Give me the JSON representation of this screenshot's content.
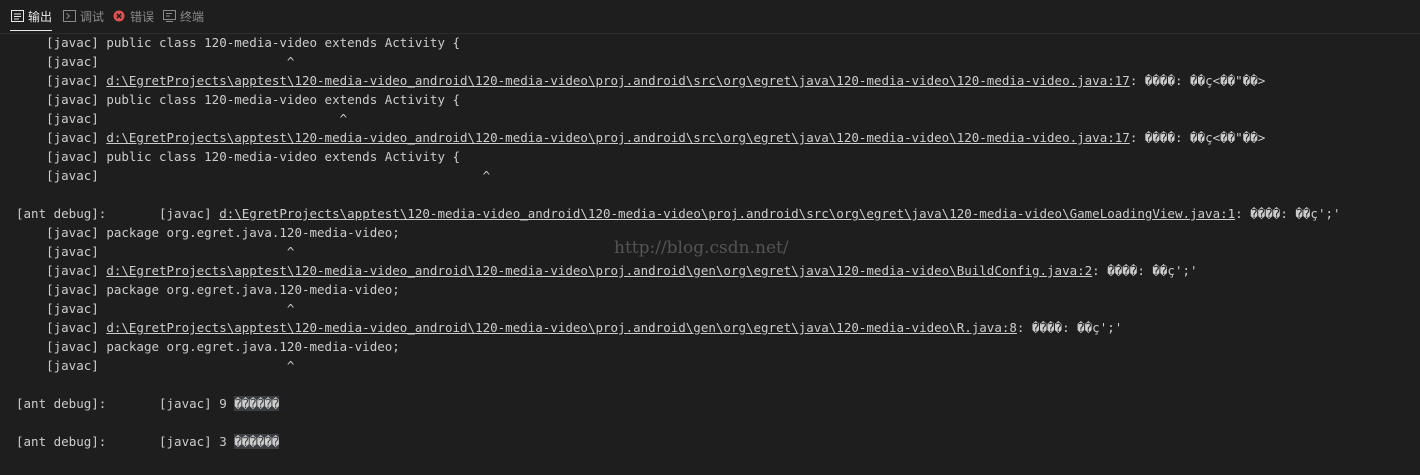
{
  "panel": {
    "tabs": [
      {
        "label": "输出",
        "icon": "output-icon",
        "active": true
      },
      {
        "label": "调试",
        "icon": "debug-console-icon",
        "active": false
      },
      {
        "label": "错误",
        "icon": "error-icon",
        "active": false
      },
      {
        "label": "终端",
        "icon": "terminal-icon",
        "active": false
      }
    ]
  },
  "colors": {
    "background": "#1e1e1e",
    "text": "#cccccc",
    "tab_active": "#e7e7e7",
    "tab_inactive": "#8a8a8a",
    "error": "#e05252",
    "highlight": "#3a3d41"
  },
  "output": {
    "lines": [
      {
        "prefix": "    [javac] ",
        "link": "",
        "suffix": "public class 120-media-video extends Activity {"
      },
      {
        "prefix": "    [javac]                         ^",
        "link": "",
        "suffix": ""
      },
      {
        "prefix": "    [javac] ",
        "link": "d:\\EgretProjects\\apptest\\120-media-video_android\\120-media-video\\proj.android\\src\\org\\egret\\java\\120-media-video\\120-media-video.java:17",
        "suffix": ": ����: ��ç<��\"��>"
      },
      {
        "prefix": "    [javac] ",
        "link": "",
        "suffix": "public class 120-media-video extends Activity {"
      },
      {
        "prefix": "    [javac]                                ^",
        "link": "",
        "suffix": ""
      },
      {
        "prefix": "    [javac] ",
        "link": "d:\\EgretProjects\\apptest\\120-media-video_android\\120-media-video\\proj.android\\src\\org\\egret\\java\\120-media-video\\120-media-video.java:17",
        "suffix": ": ����: ��ç<��\"��>"
      },
      {
        "prefix": "    [javac] ",
        "link": "",
        "suffix": "public class 120-media-video extends Activity {"
      },
      {
        "prefix": "    [javac]                                                   ^",
        "link": "",
        "suffix": ""
      },
      {
        "prefix": "",
        "link": "",
        "suffix": ""
      },
      {
        "prefix": "[ant debug]:       [javac] ",
        "link": "d:\\EgretProjects\\apptest\\120-media-video_android\\120-media-video\\proj.android\\src\\org\\egret\\java\\120-media-video\\GameLoadingView.java:1",
        "suffix": ": ����: ��ç';'"
      },
      {
        "prefix": "    [javac] ",
        "link": "",
        "suffix": "package org.egret.java.120-media-video;"
      },
      {
        "prefix": "    [javac]                         ^",
        "link": "",
        "suffix": ""
      },
      {
        "prefix": "    [javac] ",
        "link": "d:\\EgretProjects\\apptest\\120-media-video_android\\120-media-video\\proj.android\\gen\\org\\egret\\java\\120-media-video\\BuildConfig.java:2",
        "suffix": ": ����: ��ç';'"
      },
      {
        "prefix": "    [javac] ",
        "link": "",
        "suffix": "package org.egret.java.120-media-video;"
      },
      {
        "prefix": "    [javac]                         ^",
        "link": "",
        "suffix": ""
      },
      {
        "prefix": "    [javac] ",
        "link": "d:\\EgretProjects\\apptest\\120-media-video_android\\120-media-video\\proj.android\\gen\\org\\egret\\java\\120-media-video\\R.java:8",
        "suffix": ": ����: ��ç';'"
      },
      {
        "prefix": "    [javac] ",
        "link": "",
        "suffix": "package org.egret.java.120-media-video;"
      },
      {
        "prefix": "    [javac]                         ^",
        "link": "",
        "suffix": ""
      },
      {
        "prefix": "",
        "link": "",
        "suffix": ""
      },
      {
        "prefix": "[ant debug]:       [javac] 9 ",
        "link": "",
        "suffix": "",
        "hl": "������"
      },
      {
        "prefix": "",
        "link": "",
        "suffix": ""
      },
      {
        "prefix": "[ant debug]:       [javac] 3 ",
        "link": "",
        "suffix": "",
        "hl": "������"
      }
    ],
    "watermark": "http://blog.csdn.net/"
  }
}
